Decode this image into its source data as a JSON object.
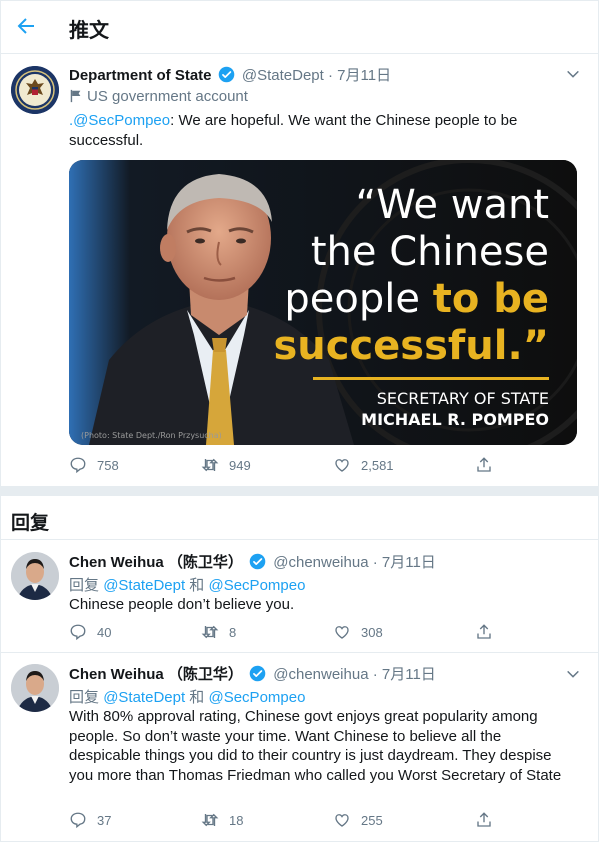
{
  "header": {
    "title": "推文"
  },
  "main_tweet": {
    "name": "Department of State",
    "handle": "@StateDept",
    "sep": "·",
    "date": "7月11日",
    "gov_label": "US government account",
    "text_prefix": ".",
    "mention": "@SecPompeo",
    "text": ": We are hopeful. We want the Chinese people to be successful.",
    "image": {
      "quote_mark": "“",
      "line1": "We want",
      "line2": "the Chinese",
      "line3_a": "people ",
      "line3_b": "to be",
      "line4": "successful.",
      "close_mark": "”",
      "role": "SECRETARY OF STATE",
      "person": "MICHAEL R. POMPEO",
      "credit": "(Photo: State Dept./Ron Przysucha)"
    },
    "stats": {
      "replies": "758",
      "retweets": "949",
      "likes": "2,581"
    }
  },
  "replies_section": {
    "title": "回复"
  },
  "replies": [
    {
      "name": "Chen Weihua （陈卫华）",
      "handle": "@chenweihua",
      "sep": "·",
      "date": "7月11日",
      "reply_prefix": "回复",
      "reply_to_1": "@StateDept",
      "reply_and": "和",
      "reply_to_2": "@SecPompeo",
      "text": "Chinese people don’t believe you.",
      "stats": {
        "replies": "40",
        "retweets": "8",
        "likes": "308"
      }
    },
    {
      "name": "Chen Weihua （陈卫华）",
      "handle": "@chenweihua",
      "sep": "·",
      "date": "7月11日",
      "reply_prefix": "回复",
      "reply_to_1": "@StateDept",
      "reply_and": "和",
      "reply_to_2": "@SecPompeo",
      "text": "With 80% approval rating, Chinese govt enjoys great popularity among people. So don’t waste your time. Want Chinese to believe all the despicable things you did to their country is just daydream. They despise you more than Thomas Friedman who called you Worst Secretary of State",
      "stats": {
        "replies": "37",
        "retweets": "18",
        "likes": "255"
      }
    }
  ],
  "colors": {
    "accent": "#1da1f2",
    "gold": "#e8b321",
    "muted": "#657786"
  },
  "icons": [
    "back-arrow-icon",
    "verified-badge-icon",
    "chevron-down-icon",
    "flag-icon",
    "reply-icon",
    "retweet-icon",
    "like-icon",
    "share-icon"
  ]
}
